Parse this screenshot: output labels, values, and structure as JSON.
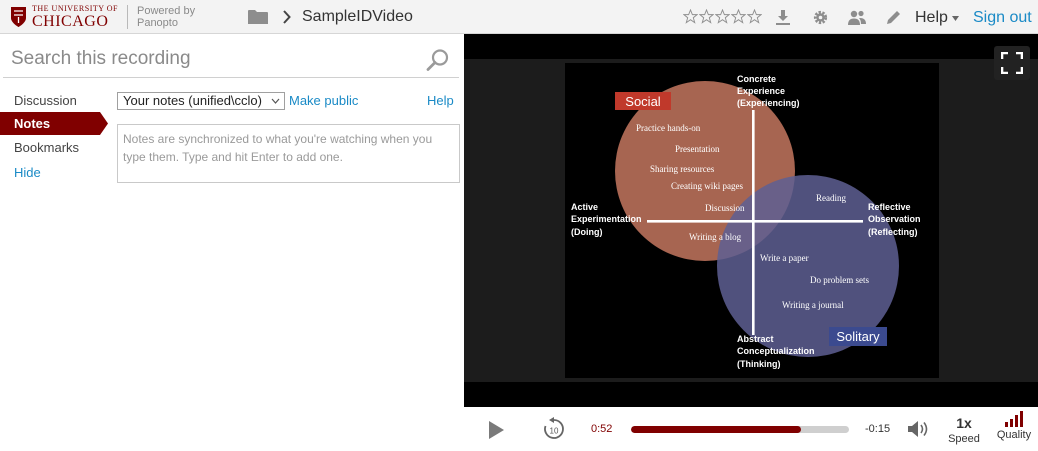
{
  "header": {
    "logo_small": "THE UNIVERSITY OF",
    "logo_big": "CHICAGO",
    "powered_by_1": "Powered by",
    "powered_by_2": "Panopto",
    "video_title": "SampleIDVideo",
    "rating_stars": 5,
    "help_label": "Help",
    "sign_out_label": "Sign out",
    "icons": [
      "folder-icon",
      "chevron-right-icon",
      "star-icon",
      "download-icon",
      "gear-icon",
      "people-icon",
      "pencil-icon",
      "caret-down-icon"
    ]
  },
  "sidebar": {
    "search_placeholder": "Search this recording",
    "items": [
      {
        "label": "Discussion",
        "active": false
      },
      {
        "label": "Notes",
        "active": true
      },
      {
        "label": "Bookmarks",
        "active": false
      },
      {
        "label": "Hide",
        "active": false
      }
    ]
  },
  "notes": {
    "channel_select_value": "Your notes (unified\\cclo)",
    "make_public_label": "Make public",
    "help_label": "Help",
    "textarea_placeholder": "Notes are synchronized to what you're watching when you type them. Type and hit Enter to add one."
  },
  "slide": {
    "social_label": "Social",
    "solitary_label": "Solitary",
    "axis_top": [
      "Concrete",
      "Experience",
      "(Experiencing)"
    ],
    "axis_left": [
      "Active",
      "Experimentation",
      "(Doing)"
    ],
    "axis_right": [
      "Reflective",
      "Observation",
      "(Reflecting)"
    ],
    "axis_bottom": [
      "Abstract",
      "Conceptualization",
      "(Thinking)"
    ],
    "social_items": [
      "Practice hands-on",
      "Presentation",
      "Sharing resources",
      "Creating wiki pages",
      "Discussion",
      "Writing a blog"
    ],
    "solitary_items": [
      "Reading",
      "Write a paper",
      "Do problem sets",
      "Writing a journal"
    ],
    "colors": {
      "social_circle": "#b06a55",
      "solitary_circle": "#5e5f93",
      "social_tag": "#c0392b",
      "solitary_tag": "#3b4a8f"
    }
  },
  "player": {
    "elapsed": "0:52",
    "remaining": "-0:15",
    "progress_fraction": 0.78,
    "rewind_seconds": "10",
    "speed_value": "1x",
    "speed_label": "Speed",
    "quality_label": "Quality",
    "accent_color": "#800000"
  }
}
